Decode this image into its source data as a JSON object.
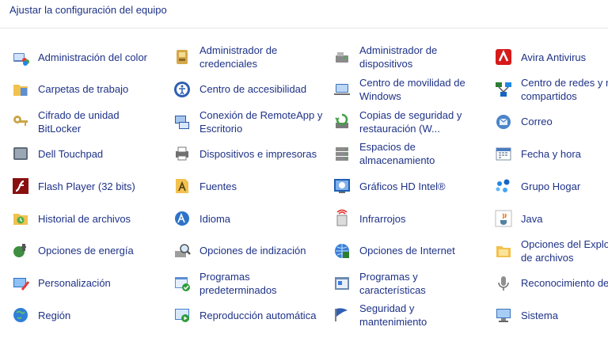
{
  "header": {
    "title": "Ajustar la configuración del equipo"
  },
  "items": [
    [
      "Administración del color",
      "Administrador de credenciales",
      "Administrador de dispositivos",
      "Avira Antivirus"
    ],
    [
      "Carpetas de trabajo",
      "Centro de accesibilidad",
      "Centro de movilidad de Windows",
      "Centro de redes y recursos compartidos"
    ],
    [
      "Cifrado de unidad BitLocker",
      "Conexión de RemoteApp y Escritorio",
      "Copias de seguridad y restauración (W...",
      "Correo"
    ],
    [
      "Dell Touchpad",
      "Dispositivos e impresoras",
      "Espacios de almacenamiento",
      "Fecha y hora"
    ],
    [
      "Flash Player (32 bits)",
      "Fuentes",
      "Gráficos HD Intel®",
      "Grupo Hogar"
    ],
    [
      "Historial de archivos",
      "Idioma",
      "Infrarrojos",
      "Java"
    ],
    [
      "Opciones de energía",
      "Opciones de indización",
      "Opciones de Internet",
      "Opciones del Explorador de archivos"
    ],
    [
      "Personalización",
      "Programas predeterminados",
      "Programas y características",
      "Reconocimiento de voz"
    ],
    [
      "Región",
      "Reproducción automática",
      "Seguridad y mantenimiento",
      "Sistema"
    ]
  ],
  "label_lines": [
    [
      [
        "Administración del color"
      ],
      [
        "Administrador de",
        "credenciales"
      ],
      [
        "Administrador de",
        "dispositivos"
      ],
      [
        "Avira Antivirus"
      ]
    ],
    [
      [
        "Carpetas de trabajo"
      ],
      [
        "Centro de accesibilidad"
      ],
      [
        "Centro de movilidad de",
        "Windows"
      ],
      [
        "Centro de redes y re",
        "compartidos"
      ]
    ],
    [
      [
        "Cifrado de unidad",
        "BitLocker"
      ],
      [
        "Conexión de RemoteApp y",
        "Escritorio"
      ],
      [
        "Copias de seguridad y",
        "restauración (W..."
      ],
      [
        "Correo"
      ]
    ],
    [
      [
        "Dell Touchpad"
      ],
      [
        "Dispositivos e impresoras"
      ],
      [
        "Espacios de",
        "almacenamiento"
      ],
      [
        "Fecha y hora"
      ]
    ],
    [
      [
        "Flash Player (32 bits)"
      ],
      [
        "Fuentes"
      ],
      [
        "Gráficos HD Intel®"
      ],
      [
        "Grupo Hogar"
      ]
    ],
    [
      [
        "Historial de archivos"
      ],
      [
        "Idioma"
      ],
      [
        "Infrarrojos"
      ],
      [
        "Java"
      ]
    ],
    [
      [
        "Opciones de energía"
      ],
      [
        "Opciones de indización"
      ],
      [
        "Opciones de Internet"
      ],
      [
        "Opciones del Explor",
        "de archivos"
      ]
    ],
    [
      [
        "Personalización"
      ],
      [
        "Programas",
        "predeterminados"
      ],
      [
        "Programas y",
        "características"
      ],
      [
        "Reconocimiento de"
      ]
    ],
    [
      [
        "Región"
      ],
      [
        "Reproducción automática"
      ],
      [
        "Seguridad y",
        "mantenimiento"
      ],
      [
        "Sistema"
      ]
    ]
  ],
  "icons": [
    [
      "color-management-icon",
      "credential-manager-icon",
      "device-manager-icon",
      "avira-icon"
    ],
    [
      "work-folders-icon",
      "ease-of-access-icon",
      "mobility-center-icon",
      "network-sharing-icon"
    ],
    [
      "bitlocker-icon",
      "remoteapp-icon",
      "backup-restore-icon",
      "mail-icon"
    ],
    [
      "touchpad-icon",
      "devices-printers-icon",
      "storage-spaces-icon",
      "date-time-icon"
    ],
    [
      "flash-player-icon",
      "fonts-icon",
      "intel-graphics-icon",
      "homegroup-icon"
    ],
    [
      "file-history-icon",
      "language-icon",
      "infrared-icon",
      "java-icon"
    ],
    [
      "power-options-icon",
      "indexing-options-icon",
      "internet-options-icon",
      "file-explorer-options-icon"
    ],
    [
      "personalization-icon",
      "default-programs-icon",
      "programs-features-icon",
      "speech-recognition-icon"
    ],
    [
      "region-icon",
      "autoplay-icon",
      "security-maintenance-icon",
      "system-icon"
    ]
  ],
  "colors": {
    "link": "#1e3287",
    "divider": "#e6e6e6",
    "background": "#ffffff"
  }
}
